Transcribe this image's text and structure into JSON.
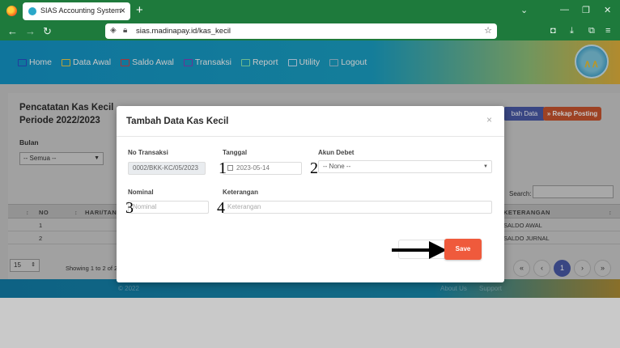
{
  "browser": {
    "tab_title": "SIAS Accounting System",
    "tab_close": "×",
    "new_tab": "+",
    "url": "sias.madinapay.id/kas_kecil"
  },
  "menu": {
    "items": [
      {
        "label": "Home",
        "icon": "home-icon"
      },
      {
        "label": "Data Awal",
        "icon": "monitor-icon"
      },
      {
        "label": "Saldo Awal",
        "icon": "chart-icon"
      },
      {
        "label": "Transaksi",
        "icon": "cart-icon"
      },
      {
        "label": "Report",
        "icon": "report-icon"
      },
      {
        "label": "Utility",
        "icon": "tools-icon"
      },
      {
        "label": "Logout",
        "icon": "logout-icon"
      }
    ]
  },
  "page": {
    "title_line1": "Pencatatan Kas Kecil",
    "title_line2": "Periode 2022/2023",
    "btn_tambah": "bah Data",
    "btn_rekap": "» Rekap Posting",
    "bulan_label": "Bulan",
    "bulan_value": "-- Semua --",
    "search_label": "Search:"
  },
  "table": {
    "headers": [
      "NO",
      "HARI/TAN",
      "KETERANGAN"
    ],
    "rows": [
      {
        "no": "1",
        "keterangan": "SALDO AWAL"
      },
      {
        "no": "2",
        "keterangan": "SALDO JURNAL"
      }
    ]
  },
  "pagination": {
    "page_size": "15",
    "showing": "Showing 1 to 2 of 2",
    "first": "«",
    "prev": "‹",
    "current": "1",
    "next": "›",
    "last": "»"
  },
  "footer": {
    "left": "© 2022",
    "right1": "About Us",
    "right2": "Support"
  },
  "modal": {
    "title": "Tambah Data Kas Kecil",
    "close": "×",
    "no_transaksi_label": "No Transaksi",
    "no_transaksi_value": "0002/BKK-KC/05/2023",
    "tanggal_label": "Tanggal",
    "tanggal_value": "2023-05-14",
    "akun_debet_label": "Akun Debet",
    "akun_debet_value": "-- None --",
    "nominal_label": "Nominal",
    "nominal_placeholder": "Nominal",
    "keterangan_label": "Keterangan",
    "keterangan_placeholder": "Keterangan",
    "save_label": "Save",
    "steps": [
      "1",
      "2",
      "3",
      "4"
    ]
  },
  "colors": {
    "browser_green": "#1e7a3c",
    "header_blue": "#1496c8",
    "save_red": "#ef5a3c",
    "rekap_red": "#c9552f",
    "tambah_blue": "#4a5aa8"
  }
}
